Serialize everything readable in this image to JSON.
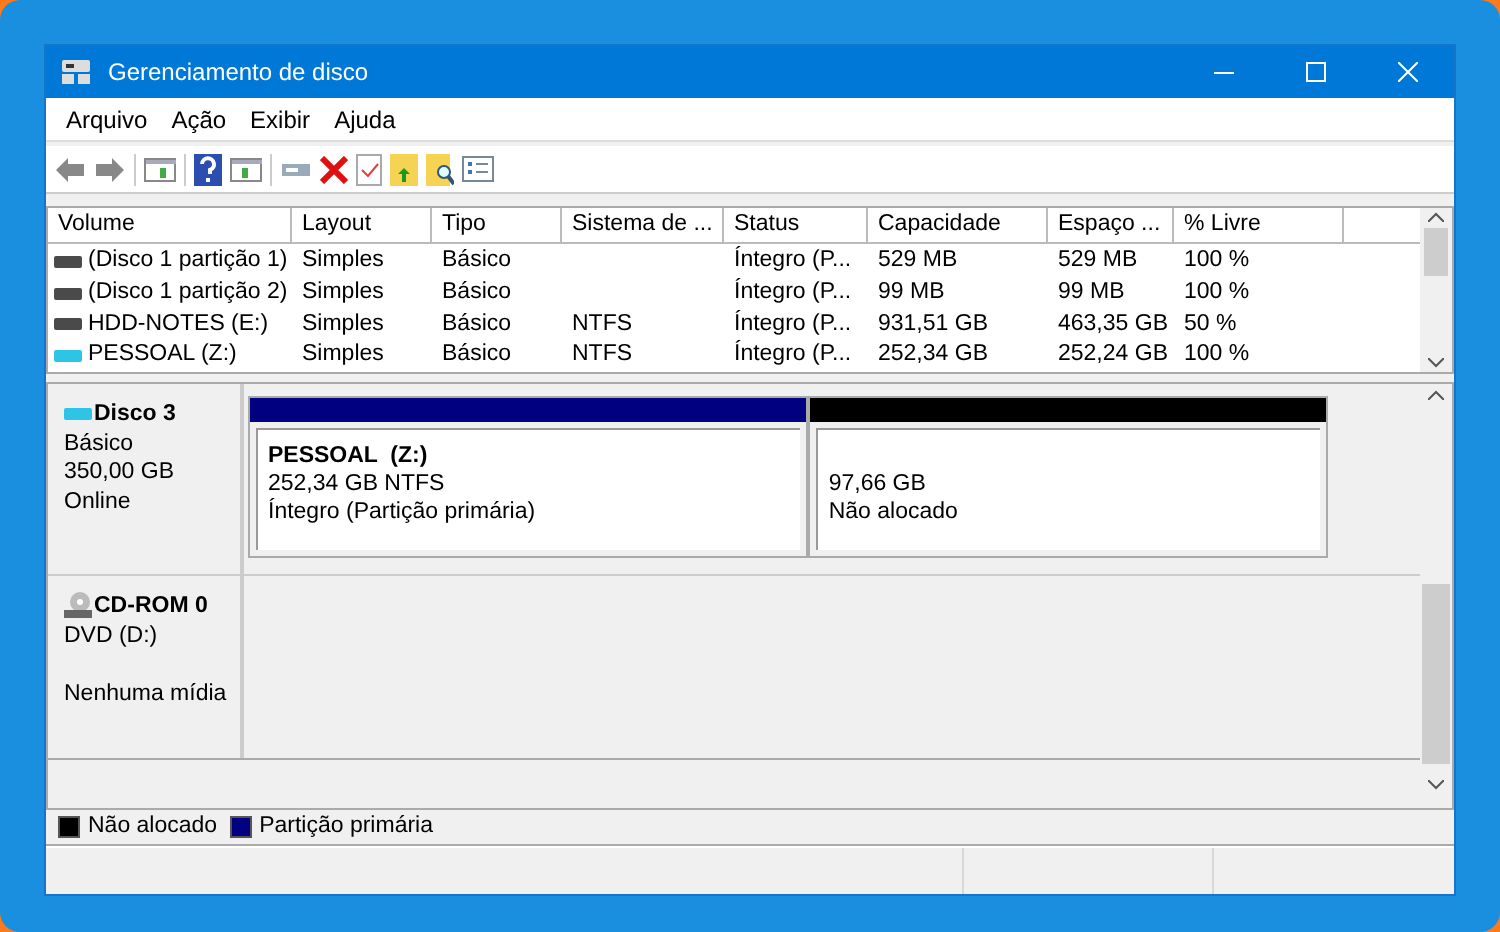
{
  "window": {
    "title": "Gerenciamento de disco"
  },
  "menu": [
    "Arquivo",
    "Ação",
    "Exibir",
    "Ajuda"
  ],
  "table": {
    "columns": [
      "Volume",
      "Layout",
      "Tipo",
      "Sistema de ...",
      "Status",
      "Capacidade",
      "Espaço ...",
      "% Livre"
    ],
    "rows": [
      {
        "color": "#4a4a4a",
        "cells": [
          "(Disco 1 partição 1)",
          "Simples",
          "Básico",
          "",
          "Íntegro (P...",
          "529 MB",
          "529 MB",
          "100 %"
        ]
      },
      {
        "color": "#4a4a4a",
        "cells": [
          "(Disco 1 partição 2)",
          "Simples",
          "Básico",
          "",
          "Íntegro (P...",
          "99 MB",
          "99 MB",
          "100 %"
        ]
      },
      {
        "color": "#4a4a4a",
        "cells": [
          "HDD-NOTES (E:)",
          "Simples",
          "Básico",
          "NTFS",
          "Íntegro (P...",
          "931,51 GB",
          "463,35 GB",
          "50 %"
        ]
      },
      {
        "color": "#2ec4e6",
        "cells": [
          "PESSOAL (Z:)",
          "Simples",
          "Básico",
          "NTFS",
          "Íntegro (P...",
          "252,34 GB",
          "252,24 GB",
          "100 %"
        ]
      }
    ]
  },
  "disks": [
    {
      "kind": "disk",
      "name": "Disco 3",
      "type": "Básico",
      "size": "350,00 GB",
      "status": "Online",
      "partitions": [
        {
          "kind": "primary",
          "title": "PESSOAL  (Z:)",
          "size": "252,34 GB NTFS",
          "status": "Íntegro (Partição primária)"
        },
        {
          "kind": "unallocated",
          "size": "97,66 GB",
          "status": "Não alocado"
        }
      ]
    },
    {
      "kind": "cdrom",
      "name": "CD-ROM 0",
      "type": "DVD (D:)",
      "status": "Nenhuma mídia"
    }
  ],
  "legend": [
    {
      "label": "Não alocado",
      "color": "#000000"
    },
    {
      "label": "Partição primária",
      "color": "#000080"
    }
  ]
}
